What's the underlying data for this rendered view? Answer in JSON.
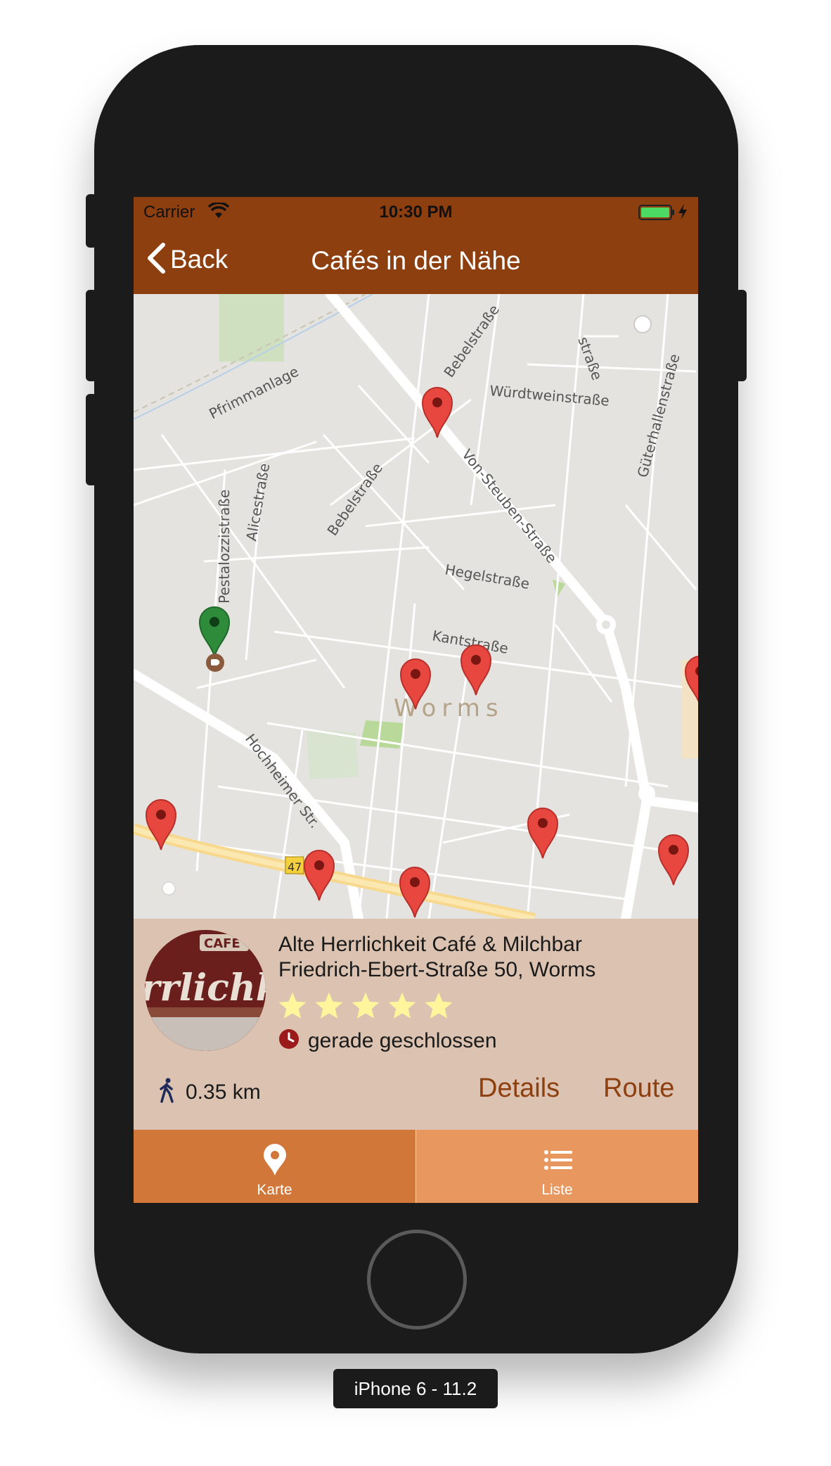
{
  "status_bar": {
    "carrier": "Carrier",
    "time": "10:30 PM",
    "icons": [
      "wifi-icon",
      "battery-icon",
      "charging-bolt-icon"
    ]
  },
  "nav": {
    "back_label": "Back",
    "title": "Cafés in der Nähe"
  },
  "map": {
    "city_label": "Worms",
    "road_shield": "47",
    "streets": [
      "Pfrimmanlage",
      "Bebelstraße",
      "Würdtweinstraße",
      "Güterhallenstraße",
      "Pestalozzistraße",
      "Alicestraße",
      "Bebelstraße",
      "Von-Steuben-Straße",
      "Hegelstraße",
      "Kantstraße",
      "Hochheimer Str.",
      "straße"
    ],
    "pin_color": "#e8473f",
    "user_pin_color": "#2e8b3a"
  },
  "cafe": {
    "name": "Alte Herrlichkeit Café & Milchbar",
    "address": "Friedrich-Ebert-Straße 50, Worms",
    "rating": 5,
    "rating_max": 5,
    "status": "gerade geschlossen",
    "distance": "0.35 km",
    "details_label": "Details",
    "route_label": "Route",
    "photo_text_top": "CAFE",
    "photo_text_main": "rrlichk"
  },
  "tabs": [
    {
      "label": "Karte",
      "icon": "map-pin-icon",
      "active": true
    },
    {
      "label": "Liste",
      "icon": "list-icon",
      "active": false
    }
  ],
  "colors": {
    "accent": "#8e3f10",
    "card_bg": "#dcc3b1",
    "tab_active": "#d2773a",
    "tab_inactive": "#e8975f",
    "star": "#fff59d"
  },
  "device_label": "iPhone 6 - 11.2"
}
